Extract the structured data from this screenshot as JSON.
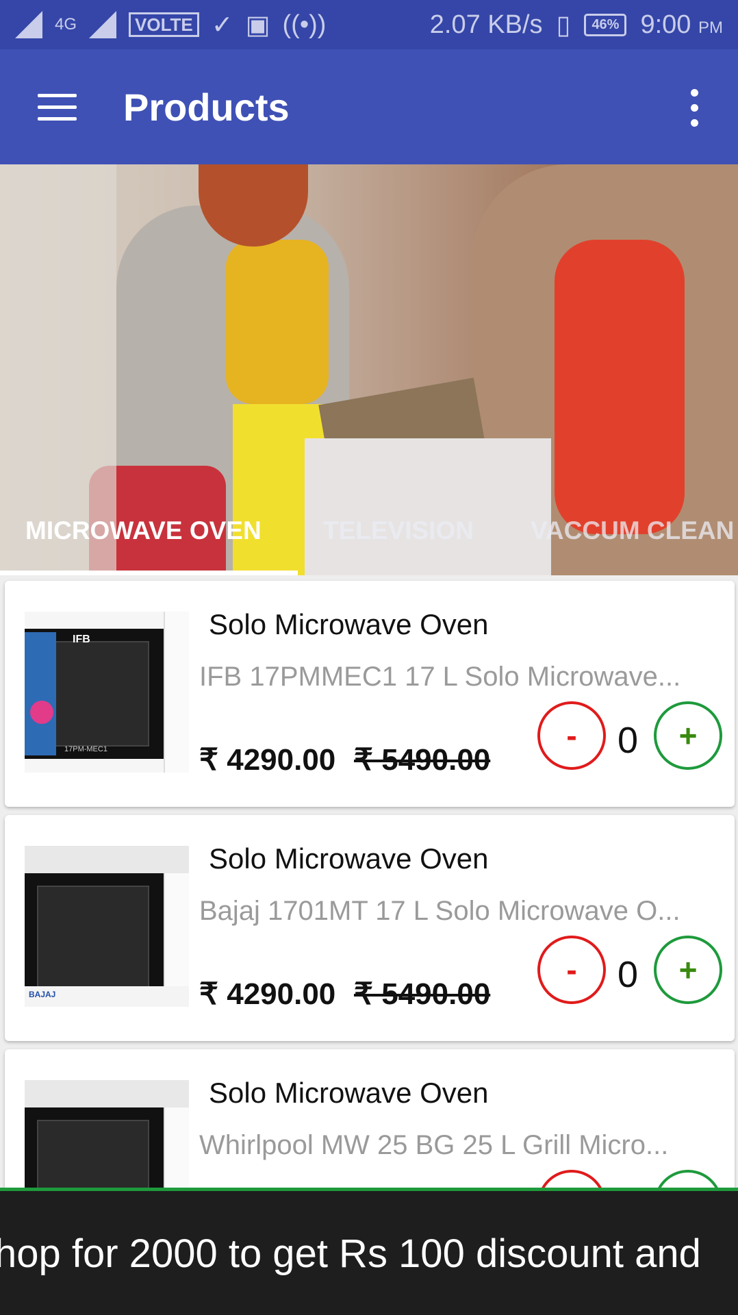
{
  "status_bar": {
    "network_label": "4G",
    "volte_label": "VOLTE",
    "speed": "2.07 KB/s",
    "battery": "46%",
    "time": "9:00",
    "time_suffix": "PM"
  },
  "app_bar": {
    "title": "Products"
  },
  "tabs": [
    {
      "label": "MICROWAVE OVEN",
      "selected": true
    },
    {
      "label": "TELEVISION",
      "selected": false
    },
    {
      "label": "VACCUM CLEAN",
      "selected": false
    }
  ],
  "products": [
    {
      "title": "Solo Microwave Oven",
      "description": "IFB 17PMMEC1 17 L Solo Microwave...",
      "price": "₹ 4290.00",
      "mrp": "₹ 5490.00",
      "minus_label": "-",
      "quantity": "0",
      "plus_label": "+",
      "brand_label": "IFB",
      "model_label": "17PM-MEC1"
    },
    {
      "title": "Solo Microwave Oven",
      "description": "Bajaj 1701MT 17 L Solo Microwave O...",
      "price": "₹ 4290.00",
      "mrp": "₹ 5490.00",
      "minus_label": "-",
      "quantity": "0",
      "plus_label": "+",
      "brand_label": "BAJAJ",
      "model_label": ""
    },
    {
      "title": "Solo Microwave Oven",
      "description": "Whirlpool MW 25 BG 25 L Grill Micro...",
      "price": "",
      "mrp": "",
      "minus_label": "",
      "quantity": "",
      "plus_label": "",
      "brand_label": "",
      "model_label": ""
    }
  ],
  "ticker": {
    "text": "hop for 2000 to get Rs 100 discount and"
  },
  "colors": {
    "primary": "#3f51b5",
    "status_bar": "#3546a8",
    "minus": "#e01b1b",
    "plus": "#1e9a3c"
  }
}
